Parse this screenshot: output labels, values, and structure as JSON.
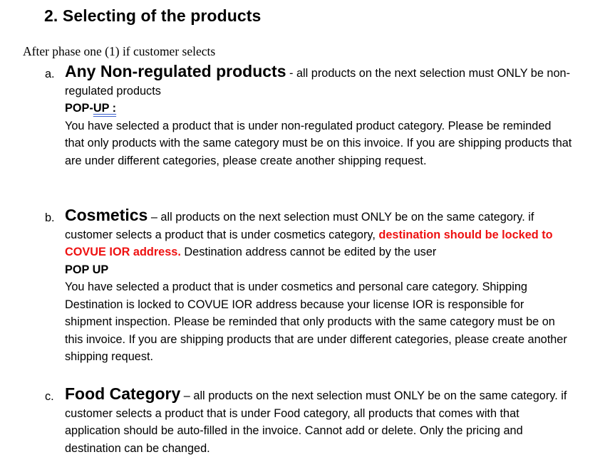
{
  "section": {
    "number": "2.",
    "title": "Selecting of the products"
  },
  "intro": "After phase one (1) if customer selects",
  "items": [
    {
      "marker": "a.",
      "title": "Any Non-regulated products",
      "desc": " - all products on the next selection must ONLY be non-regulated products",
      "popup_label_1": "POP-",
      "popup_label_2": "UP :",
      "popup_text": "You have selected a product that is under non-regulated product category. Please be reminded that only products with the same category must be on this invoice. If you are shipping products that are under different categories, please create another shipping request."
    },
    {
      "marker": "b.",
      "title": "Cosmetics",
      "desc_1": " – all products on the next selection must ONLY be on the same category. if customer selects a product that is under cosmetics category, ",
      "desc_red": "destination should be locked to COVUE IOR address.",
      "desc_2": " Destination address cannot be edited by the user",
      "popup_label": "POP UP",
      "popup_text": "You have selected a product that is under cosmetics and personal care category. Shipping Destination is locked to COVUE IOR address because your license IOR is responsible for shipment inspection. Please be reminded that only products with the same category must be on this invoice. If you are shipping products that are under different categories, please create another shipping request."
    },
    {
      "marker": "c.",
      "title": "Food Category",
      "desc": " – all products on the next selection must ONLY be on the same category. if customer selects a product that is under Food category, all products that comes with that application should be auto-filled in the invoice. Cannot add or delete. Only the pricing and destination can be changed."
    }
  ],
  "colors": {
    "highlight_red": "#ee1111",
    "link_underline": "#3a5fcd"
  }
}
